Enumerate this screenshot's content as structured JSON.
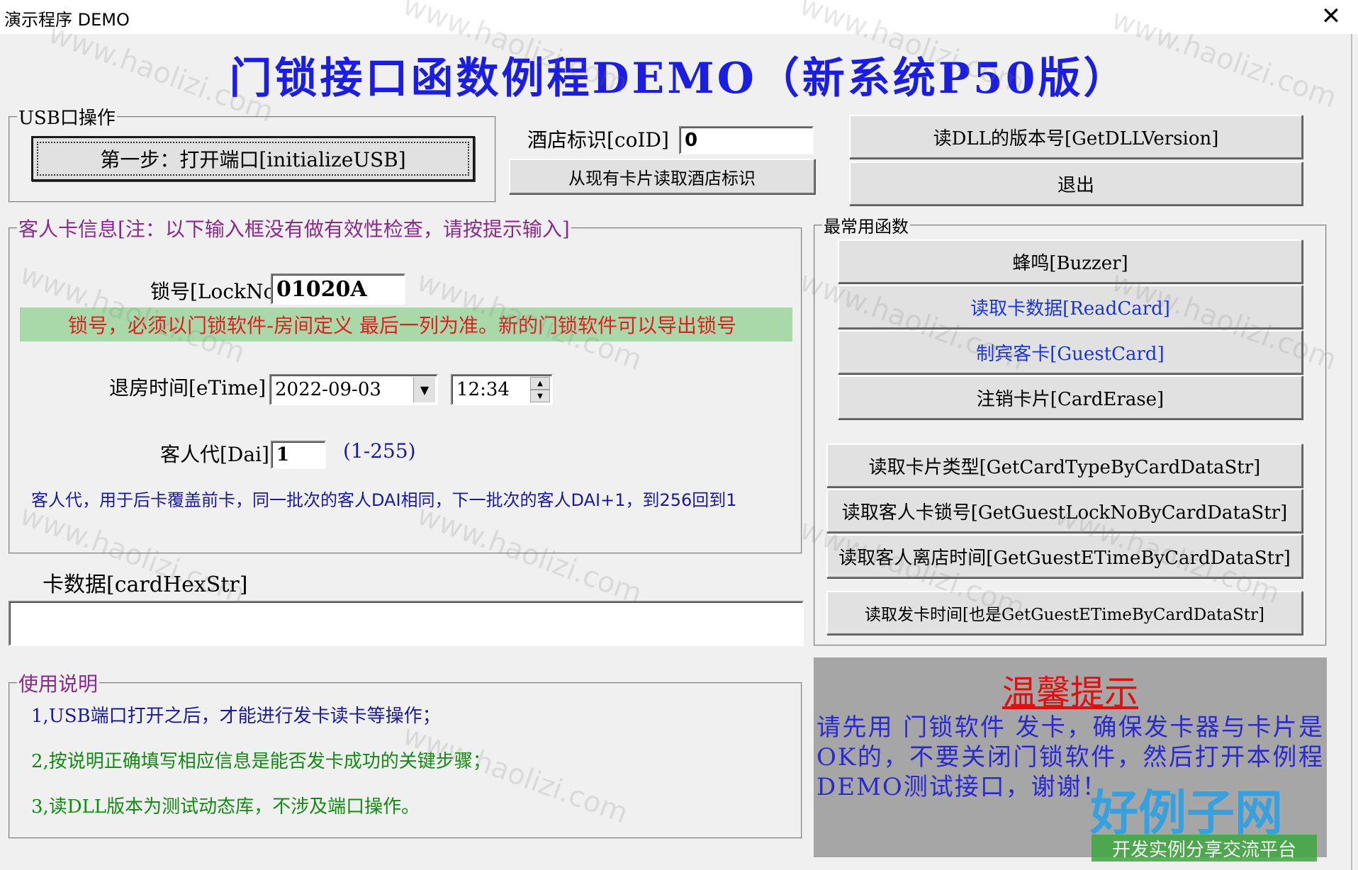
{
  "window": {
    "title": "演示程序 DEMO",
    "close_label": "✕"
  },
  "main_title": "门锁接口函数例程DEMO（新系统P50版）",
  "usb": {
    "legend": "USB口操作",
    "open_button": "第一步：打开端口[initializeUSB]"
  },
  "hotel": {
    "label": "酒店标识[coID]",
    "value": "0",
    "read_button": "从现有卡片读取酒店标识"
  },
  "top_buttons": {
    "dll_version": "读DLL的版本号[GetDLLVersion]",
    "exit": "退出"
  },
  "guest": {
    "legend": "客人卡信息[注：以下输入框没有做有效性检查，请按提示输入]",
    "lockno_label": "锁号[LockNo]",
    "lockno_value": "01020A",
    "lockno_hint": "锁号，必须以门锁软件-房间定义 最后一列为准。新的门锁软件可以导出锁号",
    "etime_label": "退房时间[eTime]",
    "etime_date": "2022-09-03",
    "etime_time": "12:34",
    "dai_label": "客人代[Dai]",
    "dai_value": "1",
    "dai_range": "(1-255)",
    "dai_hint": "客人代，用于后卡覆盖前卡，同一批次的客人DAI相同，下一批次的客人DAI+1，到256回到1"
  },
  "card_data": {
    "label": "卡数据[cardHexStr]",
    "value": ""
  },
  "usage": {
    "legend": "使用说明",
    "lines": [
      "1,USB端口打开之后，才能进行发卡读卡等操作；",
      "2,按说明正确填写相应信息是能否发卡成功的关键步骤；",
      "3,读DLL版本为测试动态库，不涉及端口操作。"
    ]
  },
  "common": {
    "legend": "最常用函数",
    "buzzer": "蜂鸣[Buzzer]",
    "read_card": "读取卡数据[ReadCard]",
    "guest_card": "制宾客卡[GuestCard]",
    "card_erase": "注销卡片[CardErase]",
    "card_type": "读取卡片类型[GetCardTypeByCardDataStr]",
    "guest_lockno": "读取客人卡锁号[GetGuestLockNoByCardDataStr]",
    "guest_etime": "读取客人离店时间[GetGuestETimeByCardDataStr]",
    "issue_time": "读取发卡时间[也是GetGuestETimeByCardDataStr]"
  },
  "tip": {
    "title": "温馨提示",
    "text": "请先用 门锁软件 发卡，确保发卡器与卡片是OK的，不要关闭门锁软件，然后打开本例程DEMO测试接口，谢谢！"
  },
  "watermark": {
    "text": "www.haolizi.com",
    "logo_main": "好例子网",
    "logo_sub": "开发实例分享交流平台"
  },
  "colors": {
    "title_blue": "#1b1ee0",
    "hint_red": "#e02020",
    "hint_bg": "#a9d9a9",
    "usage_green": "#138a13",
    "usage_blue": "#1a1a9a",
    "tip_bg": "#a6a6a6",
    "tip_title": "#e01010",
    "tip_text": "#2a2ad0"
  }
}
